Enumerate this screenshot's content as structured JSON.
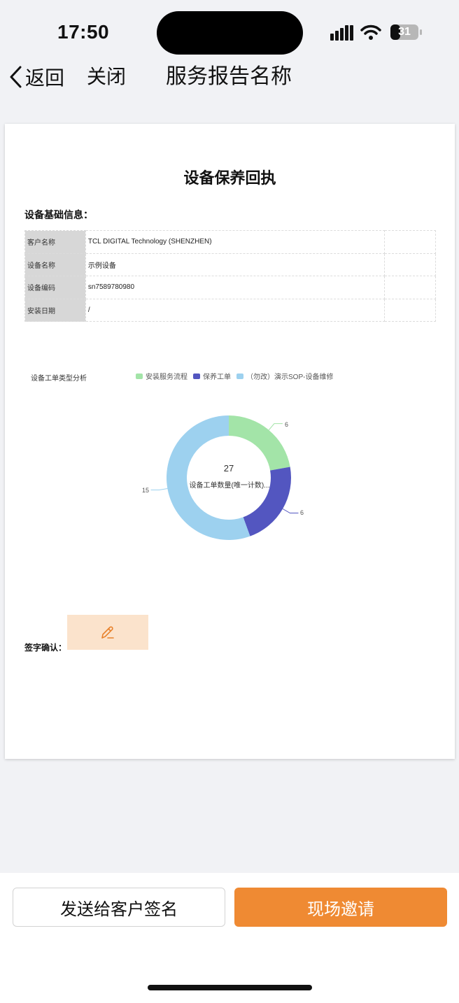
{
  "status_bar": {
    "time": "17:50",
    "battery": "31"
  },
  "nav": {
    "back_label": "返回",
    "close_label": "关闭",
    "title": "服务报告名称"
  },
  "document": {
    "title": "设备保养回执",
    "section_label": "设备基础信息：",
    "info_rows": [
      {
        "key": "客户名称",
        "value": "TCL DIGITAL Technology (SHENZHEN)"
      },
      {
        "key": "设备名称",
        "value": "示例设备"
      },
      {
        "key": "设备编码",
        "value": "sn7589780980"
      },
      {
        "key": "安装日期",
        "value": "/"
      }
    ],
    "sign_label": "签字确认："
  },
  "chart_data": {
    "type": "pie",
    "title": "设备工单类型分析",
    "categories": [
      "安装服务流程",
      "保养工单",
      "（勿改）演示SOP-设备维修"
    ],
    "values": [
      6,
      6,
      15
    ],
    "colors": [
      "#a3e4a8",
      "#5356c0",
      "#9dd1ef"
    ],
    "total": "27",
    "center_label": "设备工单数量(唯一计数)...",
    "legend_position": "top"
  },
  "buttons": {
    "send_label": "发送给客户签名",
    "invite_label": "现场邀请"
  },
  "colors": {
    "accent": "#ef8a33",
    "sign_box": "#fbe3cc"
  }
}
